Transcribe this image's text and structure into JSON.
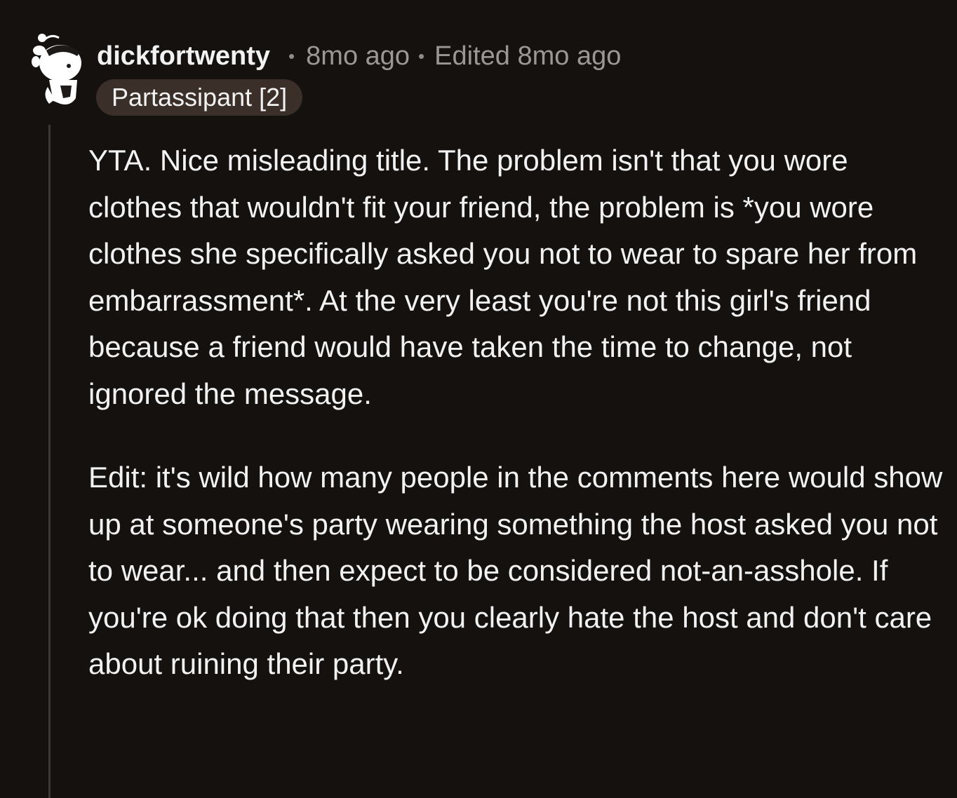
{
  "comment": {
    "username": "dickfortwenty",
    "separator": "•",
    "time": "8mo ago",
    "edited": "Edited 8mo ago",
    "flair": "Partassipant [2]",
    "paragraphs": [
      "YTA. Nice misleading title. The problem isn't that you wore clothes that wouldn't fit your friend, the problem is *you wore clothes she specifically asked you not to wear to spare her from embarrassment*. At the very least you're not this girl's friend because a friend would have taken the time to change, not ignored the message.",
      "Edit: it's wild how many people in the comments here would show up at someone's party wearing something the host asked you not to wear... and then expect to be considered not-an-asshole. If you're ok doing that then you clearly hate the host and don't care about ruining their party."
    ]
  },
  "icons": {
    "avatar": "snoo-avatar-icon"
  },
  "colors": {
    "background": "#15110f",
    "text": "#f2f2f2",
    "meta": "#9a9795",
    "flair_bg": "#3b2f2a",
    "thread_line": "#3b3836"
  }
}
